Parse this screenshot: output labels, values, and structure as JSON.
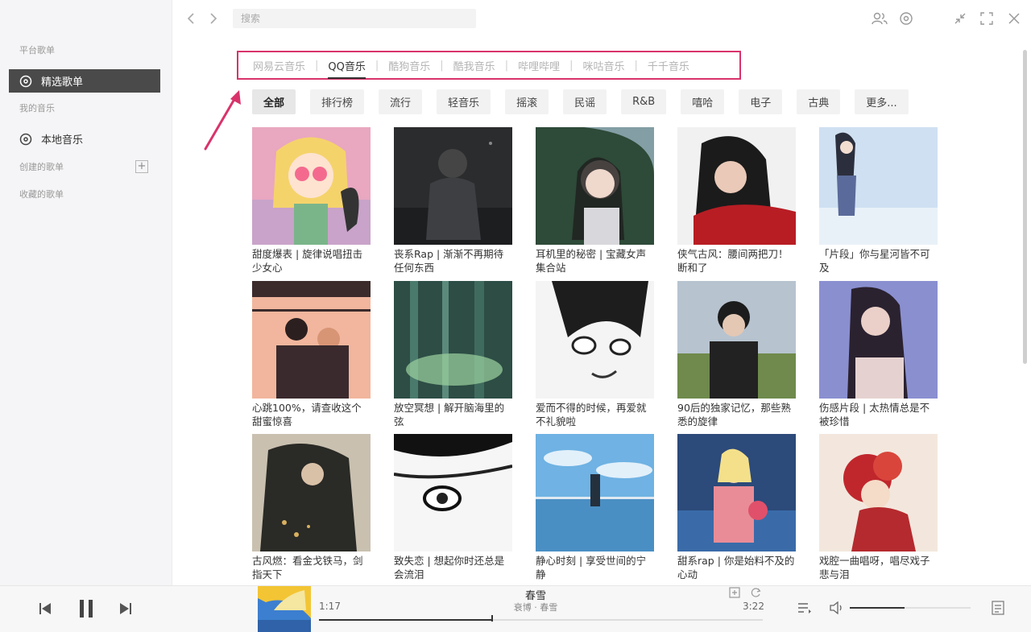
{
  "sidebar": {
    "section_platform": "平台歌单",
    "item_featured": "精选歌单",
    "section_my_music": "我的音乐",
    "item_local": "本地音乐",
    "section_created": "创建的歌单",
    "section_collected": "收藏的歌单"
  },
  "topbar": {
    "search_placeholder": "搜索"
  },
  "platforms": [
    {
      "label": "网易云音乐"
    },
    {
      "label": "QQ音乐"
    },
    {
      "label": "酷狗音乐"
    },
    {
      "label": "酷我音乐"
    },
    {
      "label": "哔哩哔哩"
    },
    {
      "label": "咪咕音乐"
    },
    {
      "label": "千千音乐"
    }
  ],
  "categories": [
    {
      "label": "全部"
    },
    {
      "label": "排行榜"
    },
    {
      "label": "流行"
    },
    {
      "label": "轻音乐"
    },
    {
      "label": "摇滚"
    },
    {
      "label": "民谣"
    },
    {
      "label": "R&B"
    },
    {
      "label": "嘻哈"
    },
    {
      "label": "电子"
    },
    {
      "label": "古典"
    },
    {
      "label": "更多..."
    }
  ],
  "playlists": [
    {
      "title": "甜度爆表 | 旋律说唱扭击少女心"
    },
    {
      "title": "丧系Rap | 渐渐不再期待任何东西"
    },
    {
      "title": "耳机里的秘密 | 宝藏女声集合站"
    },
    {
      "title": "侠气古风：腰间两把刀！断和了"
    },
    {
      "title": "「片段」你与星河皆不可及"
    },
    {
      "title": "心跳100%，请查收这个甜蜜惊喜"
    },
    {
      "title": "放空冥想 | 解开脑海里的弦"
    },
    {
      "title": "爱而不得的时候，再爱就不礼貌啦"
    },
    {
      "title": "90后的独家记忆，那些熟悉的旋律"
    },
    {
      "title": "伤感片段 | 太热情总是不被珍惜"
    },
    {
      "title": "古风燃：看金戈铁马，剑指天下"
    },
    {
      "title": "致失恋 | 想起你时还总是会流泪"
    },
    {
      "title": "静心时刻 | 享受世间的宁静"
    },
    {
      "title": "甜系rap | 你是始料不及的心动"
    },
    {
      "title": "戏腔一曲唱呀，唱尽戏子悲与泪"
    }
  ],
  "player": {
    "song": "春雪",
    "artist": "衰博 · 春雪",
    "current_time": "1:17",
    "total_time": "3:22",
    "progress_fraction": 0.39,
    "volume_fraction": 0.45
  },
  "colors": {
    "highlight_border": "#d9336b",
    "annotation_arrow": "#d9336b",
    "active_sidebar": "#4a4a4a"
  }
}
